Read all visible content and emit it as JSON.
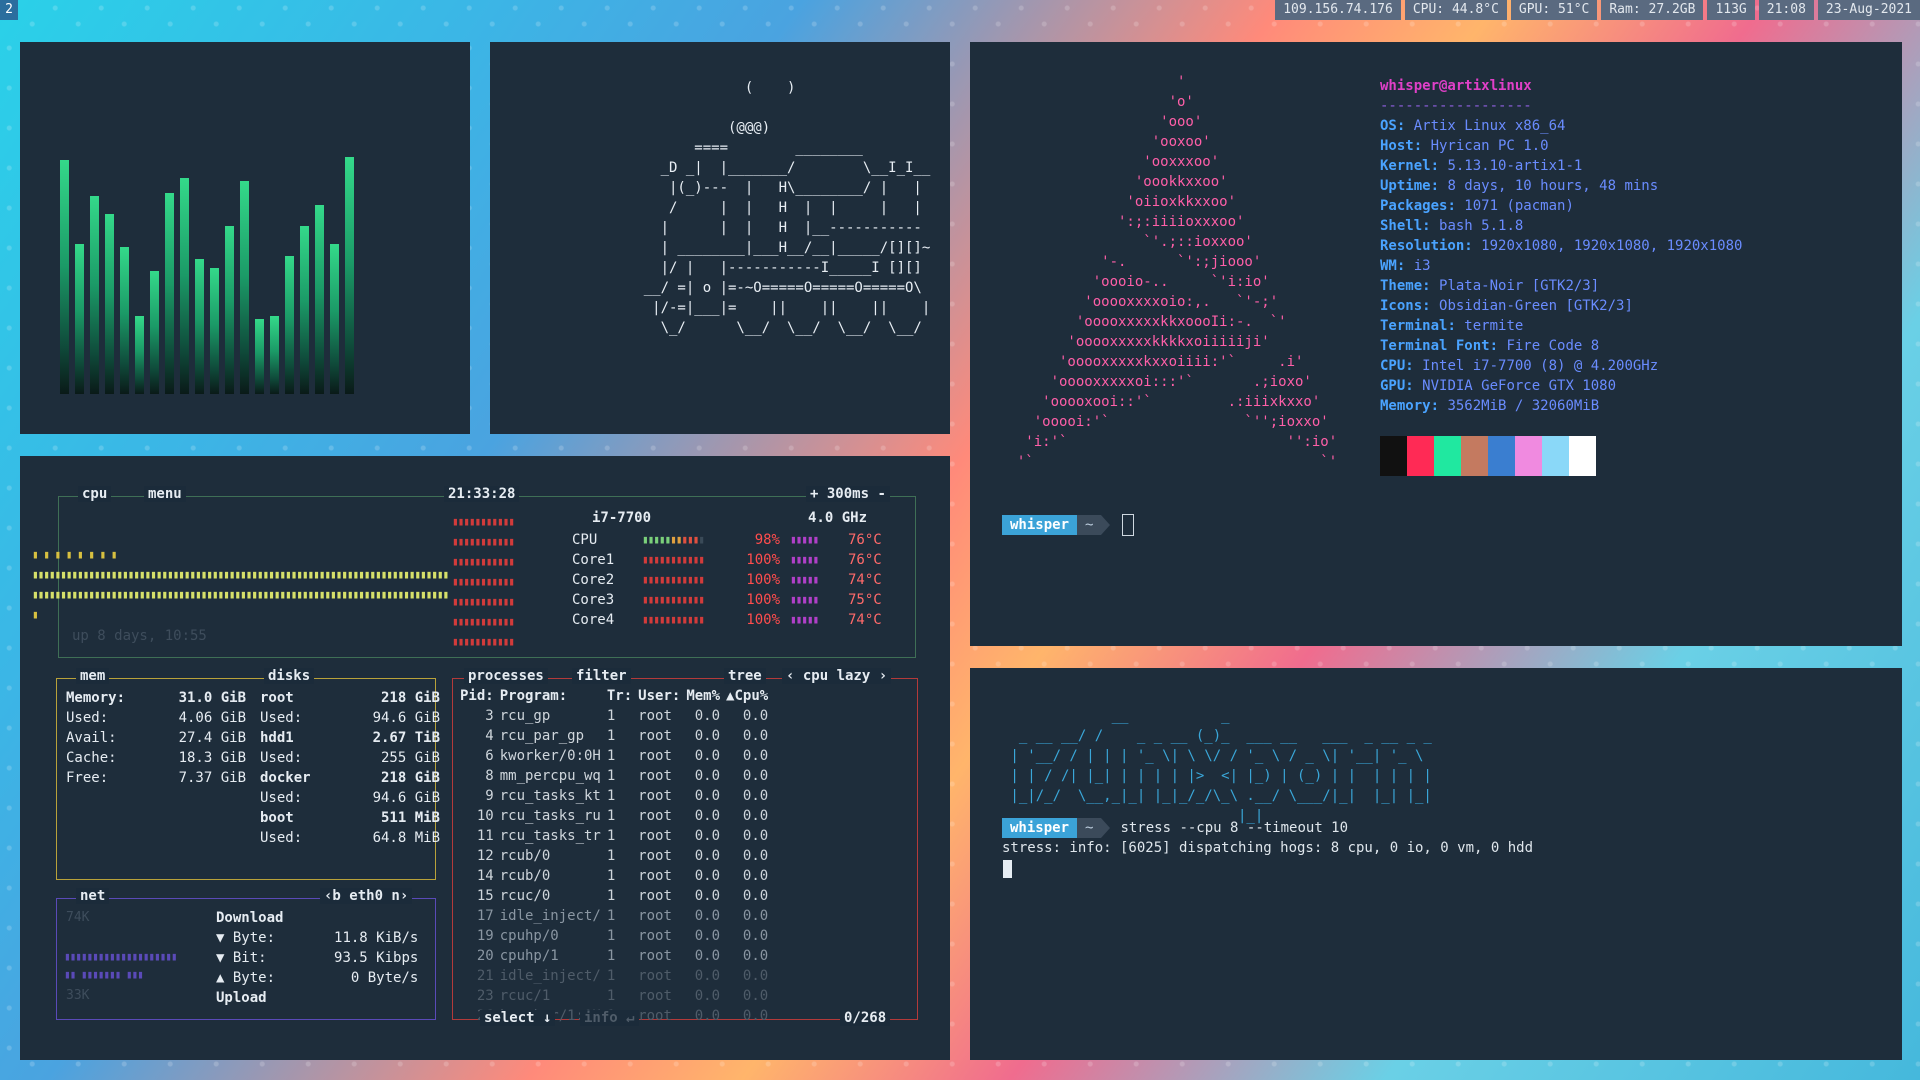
{
  "workspace": "2",
  "status_bar": [
    "109.156.74.176",
    "CPU: 44.8°C",
    "GPU: 51°C",
    "Ram: 27.2GB",
    "113G",
    "21:08",
    "23-Aug-2021"
  ],
  "cava": {
    "levels": [
      0.78,
      0.5,
      0.66,
      0.6,
      0.49,
      0.26,
      0.41,
      0.67,
      0.72,
      0.45,
      0.42,
      0.56,
      0.71,
      0.25,
      0.26,
      0.46,
      0.56,
      0.63,
      0.5,
      0.79
    ]
  },
  "train_ascii": "                (    )\n\n              (@@@)\n          ====        ________\n      _D _|  |_______/        \\__I_I__\n       |(_)---  |   H\\________/ |   |\n       /     |  |   H  |  |     |   |\n      |      |  |   H  |__-----------\n      | ________|___H__/__|_____/[][]~\n      |/ |   |-----------I_____I [][]\n    __/ =| o |=-~O=====O=====O=====O\\\n     |/-=|___|=    ||    ||    ||    |\n      \\_/      \\__/  \\__/  \\__/  \\__/",
  "neofetch": {
    "logo": "                     '\n                    'o'\n                   'ooo'\n                  'ooxoo'\n                 'ooxxxoo'\n                'oookkxxoo'\n               'oiioxkkxxoo'\n              ':;:iiiioxxxoo'\n                 `'.;::ioxxoo'\n            '-.      `':;jiooo'\n           'oooio-..     `'i:io'\n          'ooooxxxxoio:,.   `'-;'\n         'ooooxxxxxkkxoooIi:-.  `'\n        'ooooxxxxxkkkkxoiiiiiji'\n       'ooooxxxxxkxxoiiii:'`     .i'\n      'ooooxxxxxoi:::'`       .;ioxo'\n     'ooooxooi::'`         .:iiixkxxo'\n    'ooooi:'`                `'';ioxxo'\n   'i:'`                          '':io'\n  '`                                  `'",
    "title": "whisper@artixlinux",
    "separator": "------------------",
    "info": [
      {
        "key": "OS",
        "value": "Artix Linux x86_64"
      },
      {
        "key": "Host",
        "value": "Hyrican PC 1.0"
      },
      {
        "key": "Kernel",
        "value": "5.13.10-artix1-1"
      },
      {
        "key": "Uptime",
        "value": "8 days, 10 hours, 48 mins"
      },
      {
        "key": "Packages",
        "value": "1071 (pacman)"
      },
      {
        "key": "Shell",
        "value": "bash 5.1.8"
      },
      {
        "key": "Resolution",
        "value": "1920x1080, 1920x1080, 1920x1080"
      },
      {
        "key": "WM",
        "value": "i3"
      },
      {
        "key": "Theme",
        "value": "Plata-Noir [GTK2/3]"
      },
      {
        "key": "Icons",
        "value": "Obsidian-Green [GTK2/3]"
      },
      {
        "key": "Terminal",
        "value": "termite"
      },
      {
        "key": "Terminal Font",
        "value": "Fire Code 8"
      },
      {
        "key": "CPU",
        "value": "Intel i7-7700 (8) @ 4.200GHz"
      },
      {
        "key": "GPU",
        "value": "NVIDIA GeForce GTX 1080"
      },
      {
        "key": "Memory",
        "value": "3562MiB / 32060MiB"
      }
    ],
    "palette": [
      "#111111",
      "#ff2a55",
      "#20e8a0",
      "#c47a60",
      "#3a7ed0",
      "#f08ae0",
      "#8ad8f8",
      "#ffffff"
    ]
  },
  "prompt": {
    "user": "whisper",
    "dir": "~"
  },
  "stress": {
    "art": "             __           _\n  _ __ __/ /    _ _ __ (_)_  ___ __   ___  _ __ _ _\n | '__/ / | | | '_ \\| \\ \\/ / '_ \\ / _ \\| '__| '_ \\\n | | / /| |_| | | | | |>  <| |_) | (_) | |  | | | |\n |_|/_/  \\__,_|_| |_|_/_/\\_\\ .__/ \\___/|_|  |_| |_|\n                            |_|",
    "command": "stress --cpu 8 --timeout 10",
    "output": "stress: info: [6025] dispatching hogs: 8 cpu, 0 io, 0 vm, 0 hdd"
  },
  "btop": {
    "cpu_title": "cpu",
    "menu_title": "menu",
    "clock": "21:33:28",
    "refresh": "300ms",
    "uptime": "up 8 days, 10:55",
    "cpu_model": "i7-7700",
    "cpu_freq": "4.0 GHz",
    "cores": [
      {
        "name": "CPU",
        "pct": "98%",
        "temp": "76°C"
      },
      {
        "name": "Core1",
        "pct": "100%",
        "temp": "76°C"
      },
      {
        "name": "Core2",
        "pct": "100%",
        "temp": "74°C"
      },
      {
        "name": "Core3",
        "pct": "100%",
        "temp": "75°C"
      },
      {
        "name": "Core4",
        "pct": "100%",
        "temp": "74°C"
      }
    ],
    "mem_title": "mem",
    "disks_title": "disks",
    "mem": [
      {
        "label": "Memory:",
        "value": "31.0 GiB"
      },
      {
        "label": "Used:",
        "value": "4.06 GiB"
      },
      {
        "label": "Avail:",
        "value": "27.4 GiB"
      },
      {
        "label": "Cache:",
        "value": "18.3 GiB"
      },
      {
        "label": "Free:",
        "value": "7.37 GiB"
      }
    ],
    "disks": [
      {
        "label": "root",
        "value": "218 GiB"
      },
      {
        "label": "Used:",
        "value": "94.6 GiB"
      },
      {
        "label": "hdd1",
        "value": "2.67 TiB"
      },
      {
        "label": "Used:",
        "value": "255 GiB"
      },
      {
        "label": "docker",
        "value": "218 GiB"
      },
      {
        "label": "Used:",
        "value": "94.6 GiB"
      },
      {
        "label": "boot",
        "value": "511 MiB"
      },
      {
        "label": "Used:",
        "value": "64.8 MiB"
      }
    ],
    "net_title": "net",
    "net_iface": "‹b eth0 n›",
    "net_scale_top": "74K",
    "net_scale_bottom": "33K",
    "net": {
      "download_label": "Download",
      "byte_dl": "11.8 KiB/s",
      "bit_dl": "93.5 Kibps",
      "byte_ul": "0 Byte/s",
      "upload_label": "Upload"
    },
    "proc_title": "processes",
    "filter_title": "filter",
    "tree_title": "tree",
    "sort_label": "‹ cpu lazy ›",
    "columns": [
      "Pid:",
      "Program:",
      "Tr:",
      "User:",
      "Mem%",
      "▲Cpu%"
    ],
    "processes": [
      [
        "3",
        "rcu_gp",
        "1",
        "root",
        "0.0",
        "0.0"
      ],
      [
        "4",
        "rcu_par_gp",
        "1",
        "root",
        "0.0",
        "0.0"
      ],
      [
        "6",
        "kworker/0:0H",
        "1",
        "root",
        "0.0",
        "0.0"
      ],
      [
        "8",
        "mm_percpu_wq",
        "1",
        "root",
        "0.0",
        "0.0"
      ],
      [
        "9",
        "rcu_tasks_kt",
        "1",
        "root",
        "0.0",
        "0.0"
      ],
      [
        "10",
        "rcu_tasks_ru",
        "1",
        "root",
        "0.0",
        "0.0"
      ],
      [
        "11",
        "rcu_tasks_tr",
        "1",
        "root",
        "0.0",
        "0.0"
      ],
      [
        "12",
        "rcub/0",
        "1",
        "root",
        "0.0",
        "0.0"
      ],
      [
        "14",
        "rcub/0",
        "1",
        "root",
        "0.0",
        "0.0"
      ],
      [
        "15",
        "rcuc/0",
        "1",
        "root",
        "0.0",
        "0.0"
      ],
      [
        "17",
        "idle_inject/",
        "1",
        "root",
        "0.0",
        "0.0"
      ],
      [
        "19",
        "cpuhp/0",
        "1",
        "root",
        "0.0",
        "0.0"
      ],
      [
        "20",
        "cpuhp/1",
        "1",
        "root",
        "0.0",
        "0.0"
      ],
      [
        "21",
        "idle_inject/",
        "1",
        "root",
        "0.0",
        "0.0"
      ],
      [
        "23",
        "rcuc/1",
        "1",
        "root",
        "0.0",
        "0.0"
      ],
      [
        "26",
        "kworker/1:0H",
        "1",
        "root",
        "0.0",
        "0.0"
      ]
    ],
    "select_label": "select ↓",
    "info_label": "info ↵",
    "proc_count": "0/268"
  }
}
